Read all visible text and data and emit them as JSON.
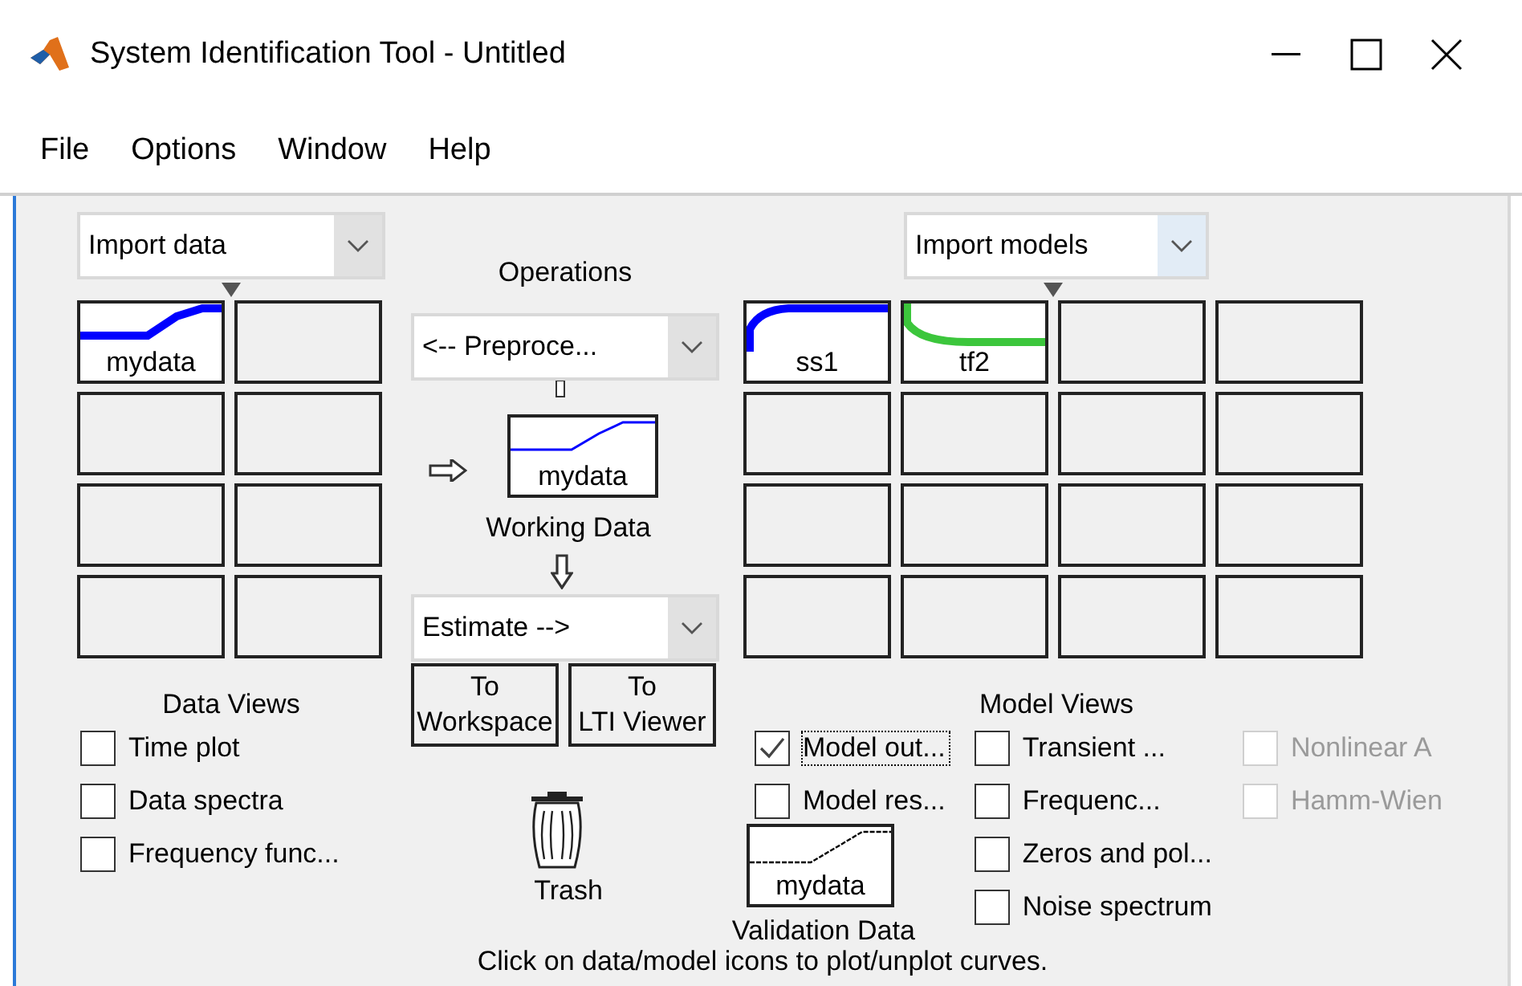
{
  "window": {
    "title": "System Identification Tool - Untitled"
  },
  "menu": [
    "File",
    "Options",
    "Window",
    "Help"
  ],
  "data_panel": {
    "dropdown": {
      "value": "Import data",
      "hovered": false
    },
    "tiles": [
      {
        "kind": "data",
        "label": "mydata",
        "color": "#0000ff"
      },
      {
        "kind": "empty"
      },
      {
        "kind": "empty"
      },
      {
        "kind": "empty"
      },
      {
        "kind": "empty"
      },
      {
        "kind": "empty"
      },
      {
        "kind": "empty"
      },
      {
        "kind": "empty"
      }
    ]
  },
  "operations": {
    "title": "Operations",
    "preprocess": {
      "value": "<-- Preproce...",
      "hovered": false
    },
    "working_data": {
      "label": "mydata"
    },
    "working_caption": "Working Data",
    "estimate": {
      "value": "Estimate -->",
      "hovered": false
    },
    "buttons": [
      {
        "lines": [
          "To",
          "Workspace"
        ]
      },
      {
        "lines": [
          "To",
          "LTI Viewer"
        ]
      }
    ],
    "trash": "Trash"
  },
  "model_panel": {
    "dropdown": {
      "value": "Import models",
      "hovered": true
    },
    "tiles": [
      {
        "kind": "model",
        "label": "ss1",
        "color": "#0000ff"
      },
      {
        "kind": "model",
        "label": "tf2",
        "color": "#3cc63c"
      },
      {
        "kind": "empty"
      },
      {
        "kind": "empty"
      },
      {
        "kind": "empty"
      },
      {
        "kind": "empty"
      },
      {
        "kind": "empty"
      },
      {
        "kind": "empty"
      },
      {
        "kind": "empty"
      },
      {
        "kind": "empty"
      },
      {
        "kind": "empty"
      },
      {
        "kind": "empty"
      },
      {
        "kind": "empty"
      },
      {
        "kind": "empty"
      },
      {
        "kind": "empty"
      },
      {
        "kind": "empty"
      }
    ]
  },
  "data_views": {
    "title": "Data Views",
    "checks": [
      {
        "label": "Time plot",
        "checked": false
      },
      {
        "label": "Data spectra",
        "checked": false
      },
      {
        "label": "Frequency func...",
        "checked": false
      }
    ]
  },
  "model_views": {
    "title": "Model Views",
    "columns": [
      [
        {
          "label": "Model out...",
          "checked": true,
          "disabled": false,
          "focused": true
        },
        {
          "label": "Model res...",
          "checked": false,
          "disabled": false,
          "focused": false
        }
      ],
      [
        {
          "label": "Transient ...",
          "checked": false,
          "disabled": false,
          "focused": false
        },
        {
          "label": "Frequenc...",
          "checked": false,
          "disabled": false,
          "focused": false
        },
        {
          "label": "Zeros and pol...",
          "checked": false,
          "disabled": false,
          "focused": false
        },
        {
          "label": "Noise spectrum",
          "checked": false,
          "disabled": false,
          "focused": false
        }
      ],
      [
        {
          "label": "Nonlinear A",
          "checked": false,
          "disabled": true,
          "focused": false
        },
        {
          "label": "Hamm-Wien",
          "checked": false,
          "disabled": true,
          "focused": false
        }
      ]
    ]
  },
  "validation": {
    "label": "mydata",
    "caption": "Validation Data"
  },
  "hint": "Click on data/model icons to plot/unplot curves."
}
